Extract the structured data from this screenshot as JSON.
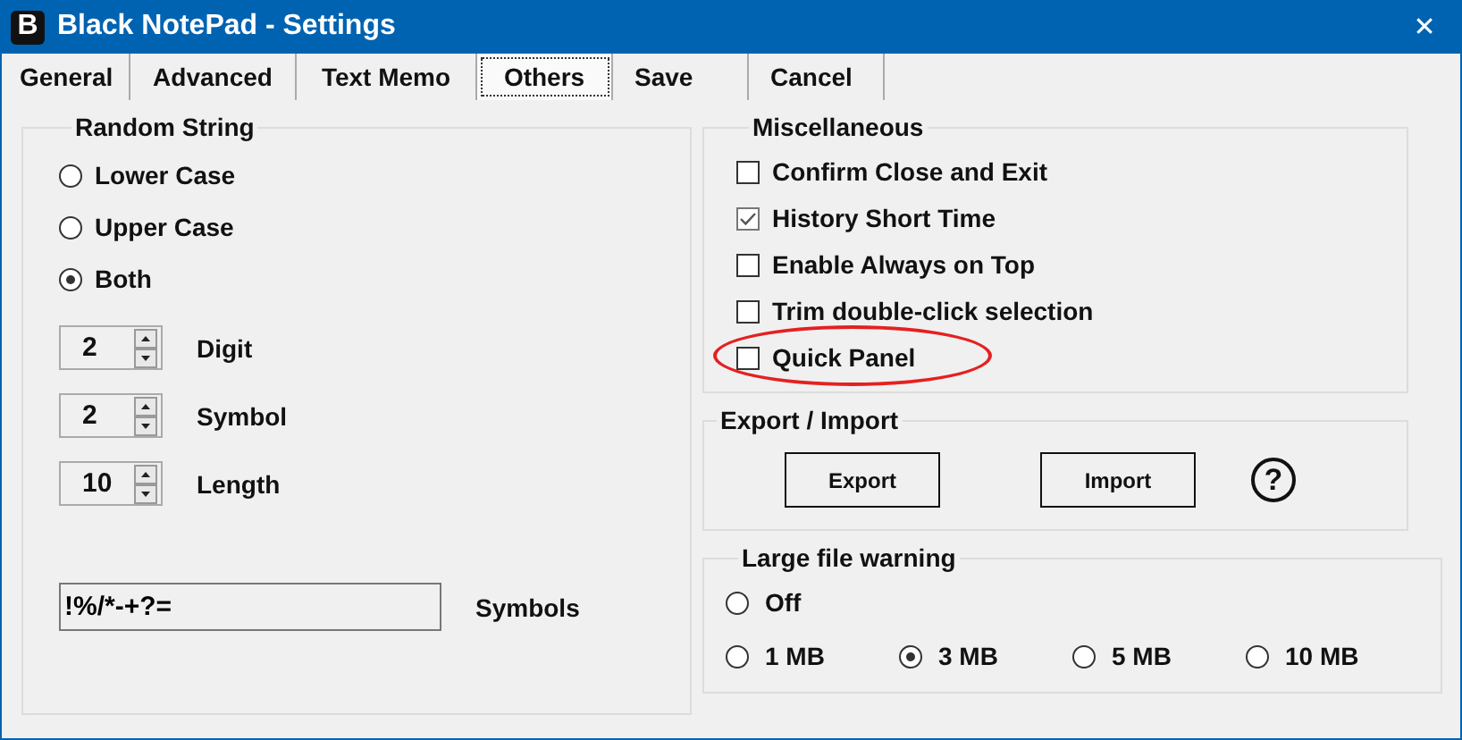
{
  "window": {
    "title": "Black NotePad - Settings",
    "app_letter": "B",
    "close": "✕"
  },
  "tabs": [
    {
      "label": "General",
      "selected": false
    },
    {
      "label": "Advanced",
      "selected": false
    },
    {
      "label": "Text Memo",
      "selected": false
    },
    {
      "label": "Others",
      "selected": true
    },
    {
      "label": "Save",
      "selected": false
    },
    {
      "label": "Cancel",
      "selected": false
    }
  ],
  "random_string": {
    "title": "Random String",
    "case_options": [
      {
        "label": "Lower Case",
        "selected": false
      },
      {
        "label": "Upper Case",
        "selected": false
      },
      {
        "label": "Both",
        "selected": true
      }
    ],
    "spinners": [
      {
        "value": "2",
        "label": "Digit"
      },
      {
        "value": "2",
        "label": "Symbol"
      },
      {
        "value": "10",
        "label": "Length"
      }
    ],
    "symbols_field": {
      "value": "!%/*-+?=",
      "label": "Symbols"
    }
  },
  "miscellaneous": {
    "title": "Miscellaneous",
    "options": [
      {
        "label": "Confirm Close and Exit",
        "checked": false,
        "highlighted": false
      },
      {
        "label": "History Short Time",
        "checked": true,
        "highlighted": false
      },
      {
        "label": "Enable Always on Top",
        "checked": false,
        "highlighted": false
      },
      {
        "label": "Trim double-click selection",
        "checked": false,
        "highlighted": false
      },
      {
        "label": "Quick Panel",
        "checked": false,
        "highlighted": true
      }
    ]
  },
  "export_import": {
    "title": "Export / Import",
    "buttons": [
      "Export",
      "Import"
    ],
    "help": "?"
  },
  "large_file_warning": {
    "title": "Large file warning",
    "rows": [
      [
        {
          "label": "Off",
          "selected": false
        }
      ],
      [
        {
          "label": "1 MB",
          "selected": false
        },
        {
          "label": "3 MB",
          "selected": true
        },
        {
          "label": "5 MB",
          "selected": false
        },
        {
          "label": "10 MB",
          "selected": false
        }
      ]
    ]
  }
}
